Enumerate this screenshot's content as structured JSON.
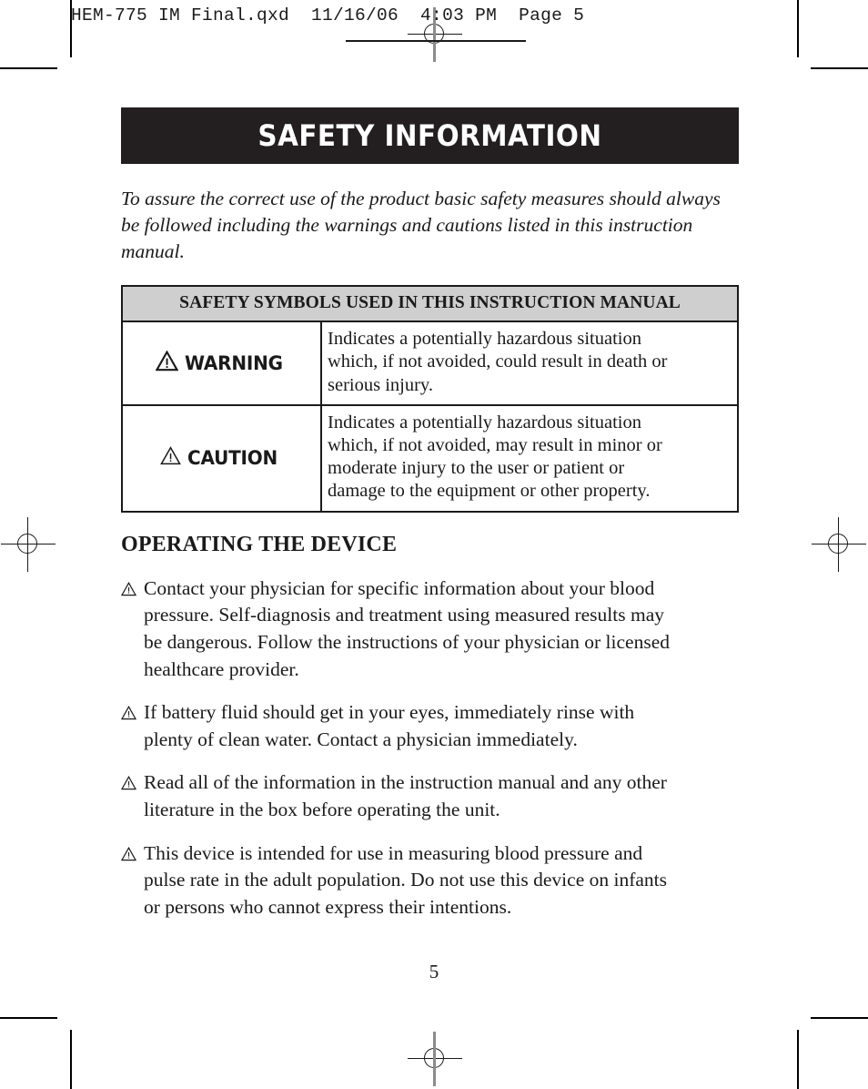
{
  "print_header": {
    "text": "HEM-775 IM Final.qxd  11/16/06  4:03 PM  Page 5"
  },
  "title_bar": {
    "text": "SAFETY INFORMATION"
  },
  "intro": {
    "text": "To assure the correct use of the product basic safety measures should always be followed including the warnings and cautions listed in this instruction manual."
  },
  "symbols_table": {
    "header": "SAFETY SYMBOLS USED IN THIS INSTRUCTION MANUAL",
    "rows": [
      {
        "icon": "warning-triangle-icon",
        "label": "WARNING",
        "description_lines": [
          "Indicates a potentially hazardous situation",
          "which, if not avoided, could result in death or",
          "serious injury."
        ]
      },
      {
        "icon": "caution-triangle-icon",
        "label": "CAUTION",
        "description_lines": [
          "Indicates a potentially hazardous situation",
          "which, if not avoided, may result in minor or",
          "moderate injury to the user or patient or",
          "damage to the equipment or other property."
        ]
      }
    ]
  },
  "section": {
    "heading": "OPERATING THE DEVICE",
    "bullets": [
      {
        "marker": "warning-triangle-icon",
        "lines": [
          "Contact your physician for specific information about your blood",
          "pressure. Self-diagnosis and treatment using measured results may",
          "be dangerous. Follow the instructions of your physician or licensed",
          "healthcare provider."
        ]
      },
      {
        "marker": "warning-triangle-icon",
        "lines": [
          "If battery fluid should get in your eyes, immediately rinse with",
          "plenty of clean water. Contact a physician immediately."
        ]
      },
      {
        "marker": "warning-triangle-icon",
        "lines": [
          "Read all of the information in the instruction manual and any other",
          "literature in the box before operating the unit."
        ]
      },
      {
        "marker": "warning-triangle-icon",
        "lines": [
          "This device is intended for use in measuring blood pressure and",
          "pulse rate in the adult population. Do not use this device on infants",
          "or persons who cannot express their intentions."
        ]
      }
    ]
  },
  "page_number": "5",
  "colors": {
    "title_bar_background": "#231f20",
    "title_bar_text": "#ffffff",
    "table_header_background": "#cfcfcf",
    "rule": "#1a1a1a",
    "registration_gray": "#8c8c8c"
  }
}
